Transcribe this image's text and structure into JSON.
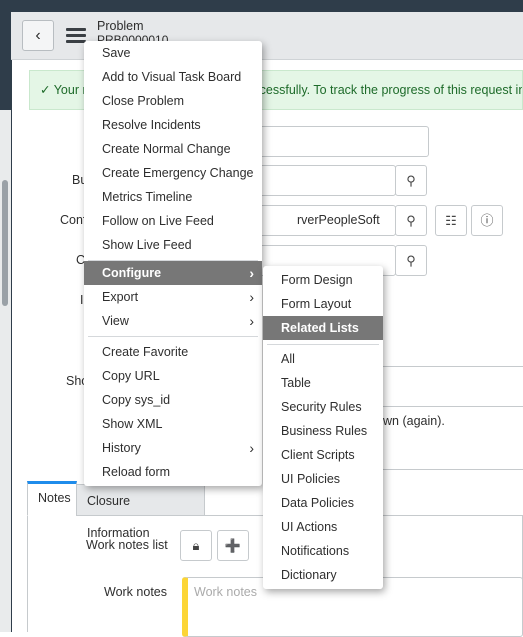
{
  "header": {
    "title": "Problem",
    "number": "PRB0000010",
    "back_icon": "chevron-left-icon",
    "menu_icon": "hamburger-icon"
  },
  "banner": {
    "text": "Your request has been submitted successfully. To track the progress of this request in S"
  },
  "form": {
    "labels": [
      "Bu",
      "Conf",
      "C",
      "I",
      "Sho"
    ],
    "ci_value": "rverPeopleSoft",
    "description_fragment": "wn (again)."
  },
  "tabs": [
    {
      "label": "Notes",
      "active": true
    },
    {
      "label": "Closure Information",
      "active": false
    }
  ],
  "notes": {
    "work_notes_list_label": "Work notes list",
    "work_notes_label": "Work notes",
    "work_notes_placeholder": "Work notes"
  },
  "context_menu": {
    "group1": [
      "Save",
      "Add to Visual Task Board",
      "Close Problem",
      "Resolve Incidents",
      "Create Normal Change",
      "Create Emergency Change",
      "Metrics Timeline",
      "Follow on Live Feed",
      "Show Live Feed"
    ],
    "group2": [
      "Configure",
      "Export",
      "View"
    ],
    "group3": [
      "Create Favorite",
      "Copy URL",
      "Copy sys_id",
      "Show XML",
      "History",
      "Reload form"
    ],
    "highlighted": "Configure"
  },
  "submenu": {
    "group1": [
      "Form Design",
      "Form Layout",
      "Related Lists"
    ],
    "group2": [
      "All",
      "Table",
      "Security Rules",
      "Business Rules",
      "Client Scripts",
      "UI Policies",
      "Data Policies",
      "UI Actions",
      "Notifications",
      "Dictionary"
    ],
    "highlighted": "Related Lists"
  },
  "colors": {
    "topbar": "#2f3d4a",
    "highlight": "#777777",
    "banner_bg": "#e4f6e6",
    "active_tab": "#1f8ceb",
    "work_notes_bar": "#fcd535"
  }
}
